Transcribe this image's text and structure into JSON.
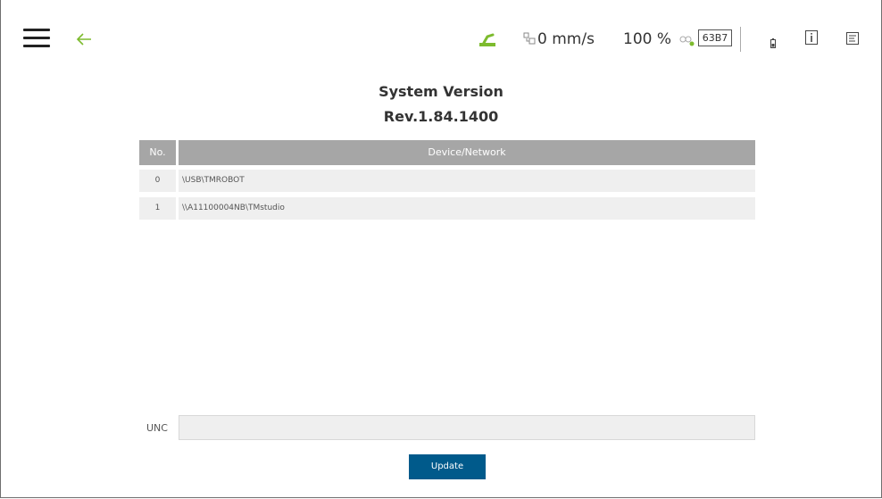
{
  "header": {
    "menu_icon": "hamburger-menu-icon",
    "back_icon": "back-arrow-icon",
    "status_icon": "robot-arm-icon",
    "status_icon_color": "#7dbb2e",
    "speed": "0 mm/s",
    "speed_percent": "100 %",
    "code_badge": "63B7",
    "accent_color": "#7dbb2e"
  },
  "page": {
    "title": "System Version",
    "revision": "Rev.1.84.1400"
  },
  "table": {
    "columns": [
      "No.",
      "Device/Network"
    ],
    "rows": [
      {
        "no": "0",
        "device": "\\USB\\TMROBOT"
      },
      {
        "no": "1",
        "device": "\\\\A11100004NB\\TMstudio"
      }
    ]
  },
  "unc": {
    "label": "UNC",
    "value": "",
    "placeholder": ""
  },
  "actions": {
    "update_label": "Update",
    "update_color": "#005a8b"
  }
}
